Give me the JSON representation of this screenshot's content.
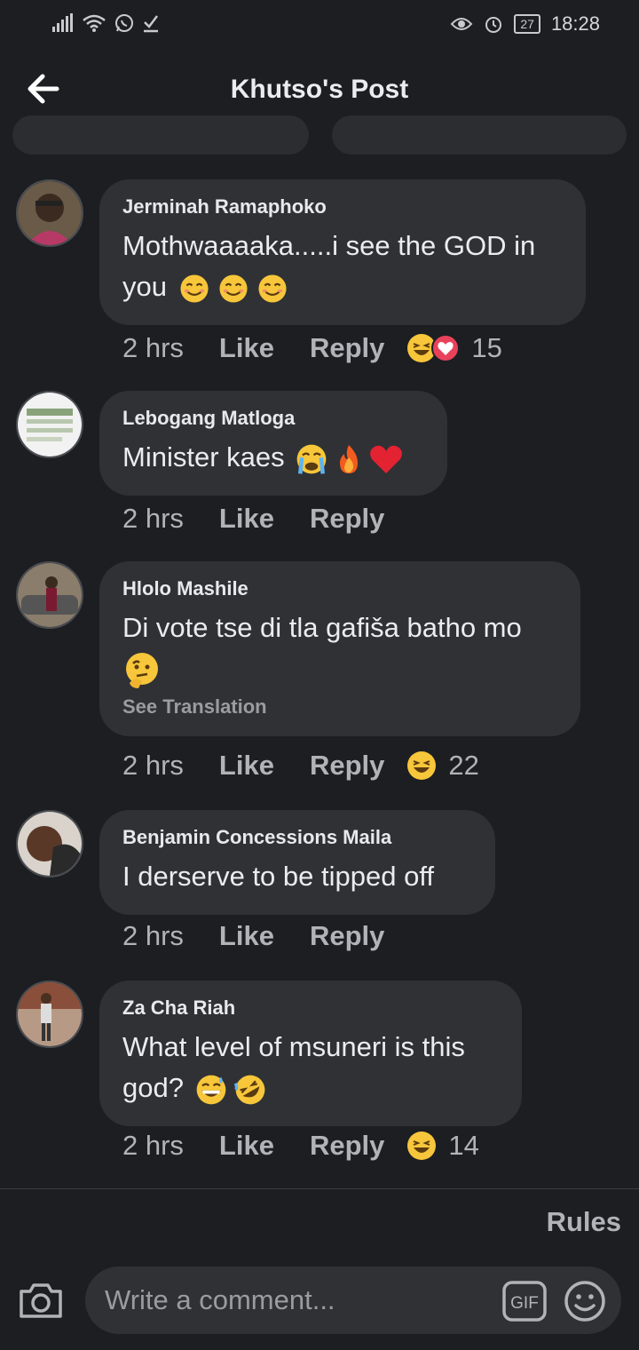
{
  "status_bar": {
    "time": "18:28",
    "battery": "27"
  },
  "header": {
    "title": "Khutso's Post"
  },
  "comments": [
    {
      "author": "Jerminah Ramaphoko",
      "text": "Mothwaaaaka.....i see the GOD in you",
      "emojis": [
        "smiling-face",
        "smiling-face",
        "smiling-face"
      ],
      "time": "2 hrs",
      "like": "Like",
      "reply": "Reply",
      "reactions": [
        "laugh",
        "love"
      ],
      "reaction_count": "15"
    },
    {
      "author": "Lebogang Matloga",
      "text": "Minister kaes",
      "emojis": [
        "crying-face",
        "fire",
        "red-heart"
      ],
      "time": "2 hrs",
      "like": "Like",
      "reply": "Reply"
    },
    {
      "author": "Hlolo Mashile",
      "text": "Di vote tse di tla gafiša batho mo",
      "emojis": [
        "thinking-face"
      ],
      "see_translation": "See Translation",
      "time": "2 hrs",
      "like": "Like",
      "reply": "Reply",
      "reactions": [
        "laugh"
      ],
      "reaction_count": "22"
    },
    {
      "author": "Benjamin Concessions Maila",
      "text": "I derserve to be tipped off",
      "time": "2 hrs",
      "like": "Like",
      "reply": "Reply"
    },
    {
      "author": "Za Cha Riah",
      "text": "What level of msuneri is this god?",
      "emojis": [
        "grinning-sweat-face",
        "rolling-laughing-face"
      ],
      "time": "2 hrs",
      "like": "Like",
      "reply": "Reply",
      "reactions": [
        "laugh"
      ],
      "reaction_count": "14"
    }
  ],
  "footer": {
    "rules": "Rules",
    "comment_placeholder": "Write a comment...",
    "gif_label": "GIF"
  },
  "colors": {
    "background": "#1c1e22",
    "bubble": "#2f3135",
    "muted_text": "#b0b3b8",
    "reaction_love": "#e8425a",
    "emoji_yellow": "#f7c63a"
  }
}
